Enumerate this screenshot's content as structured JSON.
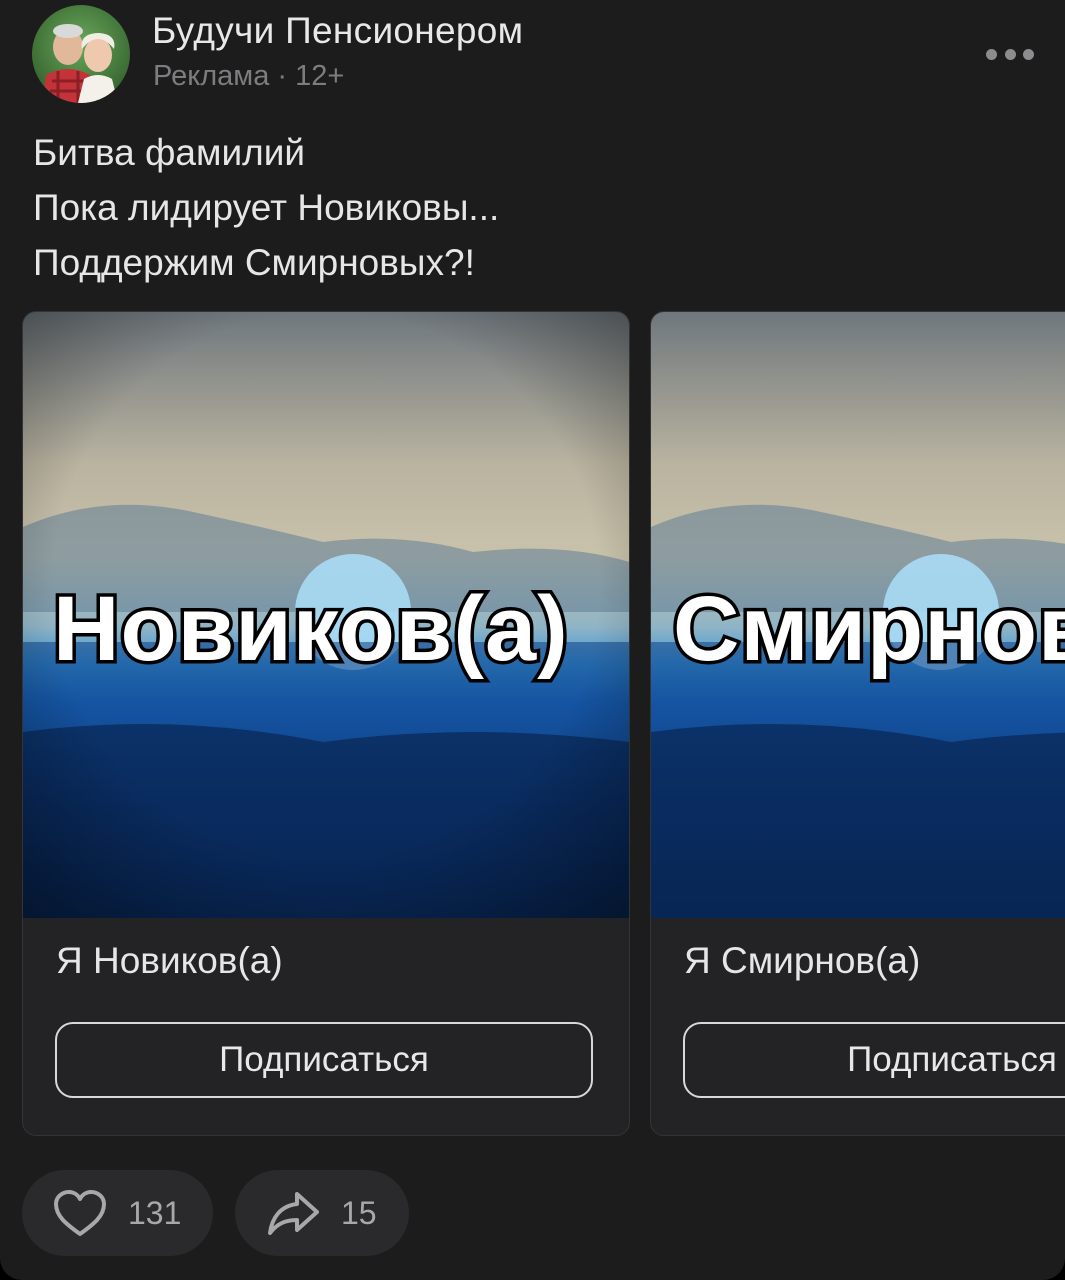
{
  "post": {
    "author": "Будучи Пенсионером",
    "meta": "Реклама · 12+",
    "text_lines": [
      "Битва фамилий",
      "Пока лидирует Новиковы...",
      "Поддержим Смирновых?!"
    ]
  },
  "cards": [
    {
      "overlay": "Новиков(а)",
      "title": "Я Новиков(а)",
      "button": "Подписаться"
    },
    {
      "overlay": "Смирнов(а)",
      "title": "Я Смирнов(а)",
      "button": "Подписаться"
    }
  ],
  "reactions": {
    "likes": "131",
    "shares": "15"
  },
  "icons": {
    "avatar": "avatar-photo",
    "more": "more-dots-icon",
    "like": "heart-icon",
    "share": "share-arrow-icon"
  },
  "colors": {
    "background": "#1c1c1d",
    "card": "#232325",
    "text": "#e6e6e6",
    "muted": "#7d7d80"
  }
}
